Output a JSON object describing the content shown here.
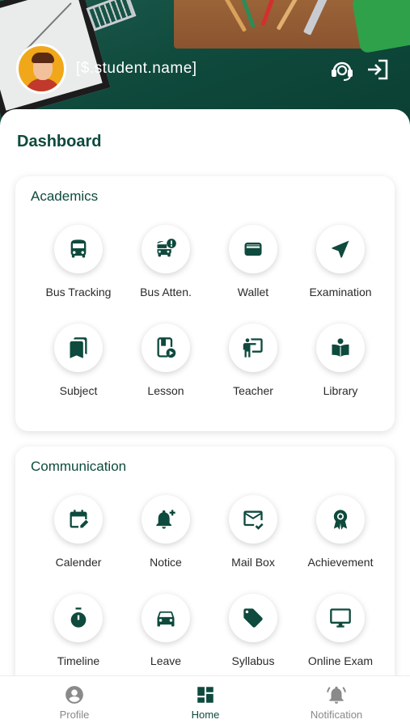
{
  "header": {
    "student_name": "[$.student.name]",
    "icons": [
      "support-agent-icon",
      "logout-icon"
    ]
  },
  "dashboard": {
    "title": "Dashboard"
  },
  "academics": {
    "title": "Academics",
    "items": [
      {
        "label": "Bus Tracking",
        "icon": "bus-icon"
      },
      {
        "label": "Bus Atten.",
        "icon": "bus-alert-icon"
      },
      {
        "label": "Wallet",
        "icon": "wallet-icon"
      },
      {
        "label": "Examination",
        "icon": "navigation-arrow-icon"
      },
      {
        "label": "Subject",
        "icon": "bookmarks-icon"
      },
      {
        "label": "Lesson",
        "icon": "video-lesson-icon"
      },
      {
        "label": "Teacher",
        "icon": "teacher-board-icon"
      },
      {
        "label": "Library",
        "icon": "reading-book-icon"
      }
    ]
  },
  "communication": {
    "title": "Communication",
    "items": [
      {
        "label": "Calender",
        "icon": "calendar-edit-icon"
      },
      {
        "label": "Notice",
        "icon": "bell-plus-icon"
      },
      {
        "label": "Mail Box",
        "icon": "mail-check-icon"
      },
      {
        "label": "Achievement",
        "icon": "award-ribbon-icon"
      },
      {
        "label": "Timeline",
        "icon": "stopwatch-icon"
      },
      {
        "label": "Leave",
        "icon": "car-icon"
      },
      {
        "label": "Syllabus",
        "icon": "tag-icon"
      },
      {
        "label": "Online Exam",
        "icon": "monitor-icon"
      }
    ]
  },
  "bottom_nav": {
    "items": [
      {
        "label": "Profile",
        "icon": "account-circle-icon",
        "active": false
      },
      {
        "label": "Home",
        "icon": "dashboard-grid-icon",
        "active": true
      },
      {
        "label": "Notification",
        "icon": "bell-ring-icon",
        "active": false
      }
    ]
  },
  "colors": {
    "primary": "#0e4a3d",
    "header_bg": "#124d40",
    "accent_orange": "#f0a81a",
    "inactive_gray": "#8a8a8a"
  }
}
